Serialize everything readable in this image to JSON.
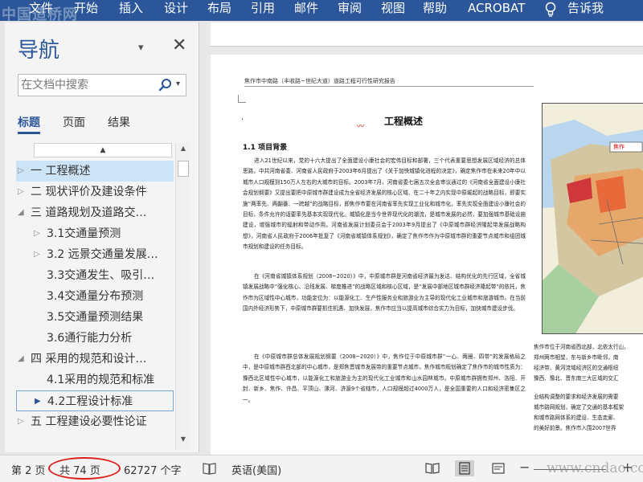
{
  "watermark_top": "中国造桥网",
  "ribbon": {
    "tabs": [
      {
        "id": "file",
        "label": "文件"
      },
      {
        "id": "home",
        "label": "开始"
      },
      {
        "id": "insert",
        "label": "插入"
      },
      {
        "id": "design",
        "label": "设计"
      },
      {
        "id": "layout",
        "label": "布局"
      },
      {
        "id": "references",
        "label": "引用"
      },
      {
        "id": "mailings",
        "label": "邮件"
      },
      {
        "id": "review",
        "label": "审阅"
      },
      {
        "id": "view",
        "label": "视图"
      },
      {
        "id": "help",
        "label": "帮助"
      },
      {
        "id": "acrobat",
        "label": "ACROBAT"
      },
      {
        "id": "tellme",
        "label": "告诉我"
      }
    ],
    "color": "#2b579a"
  },
  "nav": {
    "title": "导航",
    "search_placeholder": "在文档中搜索",
    "tabs": [
      {
        "label": "标题",
        "active": true
      },
      {
        "label": "页面",
        "active": false
      },
      {
        "label": "结果",
        "active": false
      }
    ],
    "tree_collapse_glyph": "▲",
    "items": [
      {
        "label": "一  工程概述",
        "level": 0,
        "arrow": "▷",
        "selected": true
      },
      {
        "label": "二  现状评价及建设条件",
        "level": 0,
        "arrow": "▷"
      },
      {
        "label": "三  道路规划及道路交…",
        "level": 0,
        "arrow": "◢"
      },
      {
        "label": "3.1交通量预测",
        "level": 1,
        "arrow": "▷"
      },
      {
        "label": "3.2 远景交通量发展…",
        "level": 1,
        "arrow": "▷"
      },
      {
        "label": "3.3交通发生、吸引…",
        "level": 1,
        "arrow": ""
      },
      {
        "label": "3.4交通量分布预测",
        "level": 1,
        "arrow": ""
      },
      {
        "label": "3.5交通量预测结果",
        "level": 1,
        "arrow": ""
      },
      {
        "label": "3.6通行能力分析",
        "level": 1,
        "arrow": ""
      },
      {
        "label": "四  采用的规范和设计…",
        "level": 0,
        "arrow": "◢"
      },
      {
        "label": "4.1采用的规范和标准",
        "level": 1,
        "arrow": ""
      },
      {
        "label": "4.2工程设计标准",
        "level": 1,
        "arrow": "▶",
        "current": true
      },
      {
        "label": "五  工程建设必要性论证",
        "level": 0,
        "arrow": "▷"
      }
    ]
  },
  "document": {
    "running_header": "焦作市中南路（丰收路~世纪大道）道路工程可行性研究报告",
    "chapter_title": "工程概述",
    "section_title": "1.1 项目背景",
    "paragraphs": [
      "进入21世纪以来，党的十六大提出了全面建设小康社会的宏伟目标和部署，三个代表重要思想发展区域经济的总体思路，中共河南省委、河南省人民政府于2003年6月提出了《关于加快城镇化进程的决定》，确定焦作市在未来20年中以城市人口规模到150万人左右的大城市的目标。2003年7月，河南省委七届五次全会审议通过的《河南省全面建设小康社会规划纲要》又提出要把中原城市群建设成为全省经济发展的核心区域、在二十年之内实现中原崛起的战略目标，即要实施“两率先、两翻番、一跨越”的战略目标，即焦作市要在河南省率先实现工业化和城市化，率先实现全面建设小康社会的目标，条件允许的话要率先基本实现现代化。城镇化是当今世界现代化的潮流，是城市发展的必然，要加强城市基础设施建设，增强城市的辐射和带动作用。河南省发展计划委员会于2003年9月提出了《中原城市群经济隆起带发展战略构想》，河南省人民政府于2006年批复了《河南省城镇体系规划》，确定了焦作市作为中原城市群的重要节点城市和组团城市规划和建设的任务目标。",
      "在《河南省城镇体系规划（2008~2020）》中，中原城市群是河南省经济最为发达、结构优化的先行区域，全省城镇发展战略中“强化核心、沿线发展、梯度推进”的战略区域和核心区域，是“发展中部地区城市群经济隆起带”的依托，焦作市为区域性中心城市，功能定位为：以能源化工、生产性服务业和旅游业为主导的现代化工业城市和旅游城市。在当前国内外经济形势下，中原城市群要抓住机遇、加快发展，焦作市应当以提高城市综合实力为目标，加快城市建设步伐。",
      "在《中原城市群总体发展规划纲要（2008~2020）》中，焦作位于中原城市群“一心、两圈、四带”的发展格局之中，是中原城市群西北部的中心城市，是郑焦晋城市发展带的重要节点城市。焦作城市规划确定了焦作市的城市性质为：豫西北区域性中心城市，以能源化工和旅游业为主的现代化工业城市和山水园林城市。中原城市群拥有郑州、洛阳、开封、新乡、焦作、许昌、平顶山、漯河、济源9个省辖市，人口规模超过4000万人，是全国重要的人口和经济密集区之一。"
    ],
    "side_text": [
      "焦作市位于河南省西北部，北依太行山，",
      "郑州两市相望，东与新乡市毗邻，南",
      "经济带、黄河流域经济区的交通枢纽",
      "豫西、豫北、晋东南三大区域的交汇",
      "业结构调整的要求和经济发展的需要",
      "城市路网规划，确定了交通的基本框架",
      "和城市路网体系的建设、生态走廊、",
      "的美好前景。焦作市入围2007世界"
    ],
    "map_label": "焦作"
  },
  "status": {
    "page": "第 2 页",
    "total_pages": "共 74 页",
    "word_count": "62727 个字",
    "language": "英语(美国)",
    "watermark": "www.cndao.com"
  }
}
